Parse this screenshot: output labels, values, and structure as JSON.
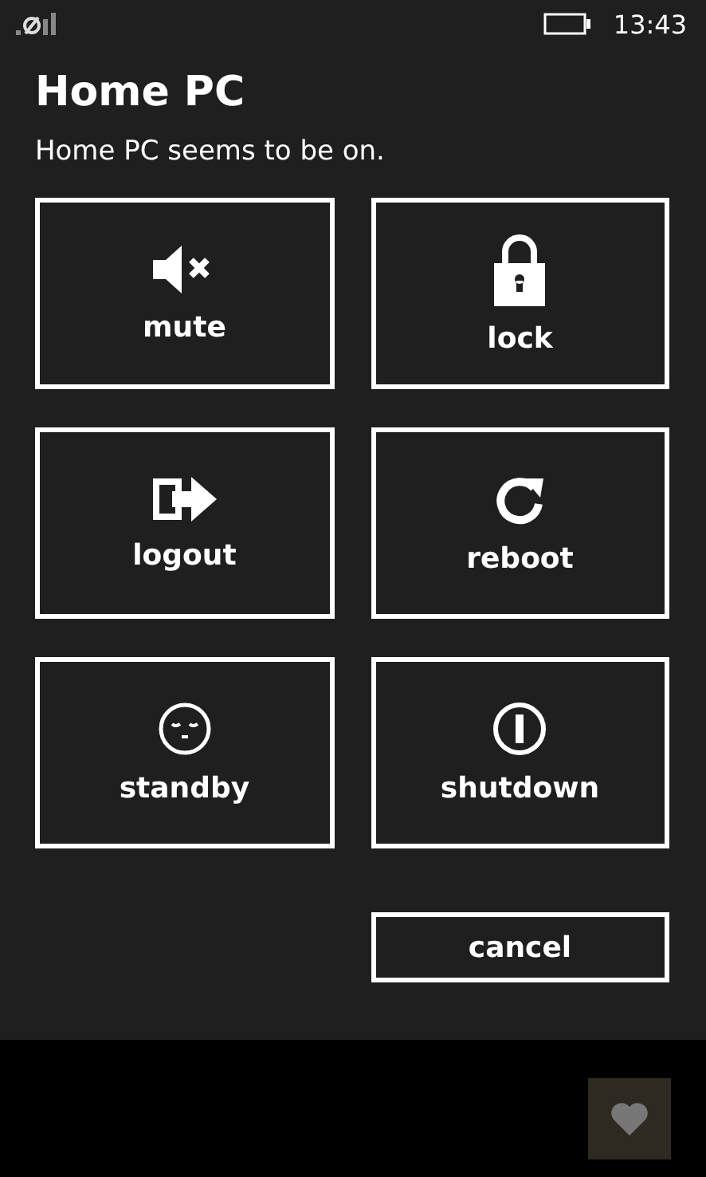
{
  "status_bar": {
    "time": "13:43"
  },
  "dialog": {
    "title": "Home PC",
    "message": "Home PC seems to be on.",
    "actions": [
      {
        "kind": "mute",
        "label": "mute"
      },
      {
        "kind": "lock",
        "label": "lock"
      },
      {
        "kind": "logout",
        "label": "logout"
      },
      {
        "kind": "reboot",
        "label": "reboot"
      },
      {
        "kind": "standby",
        "label": "standby"
      },
      {
        "kind": "shutdown",
        "label": "shutdown"
      }
    ],
    "cancel": "cancel"
  },
  "app_bar": {
    "buttons": [
      {
        "kind": "heart"
      }
    ]
  }
}
